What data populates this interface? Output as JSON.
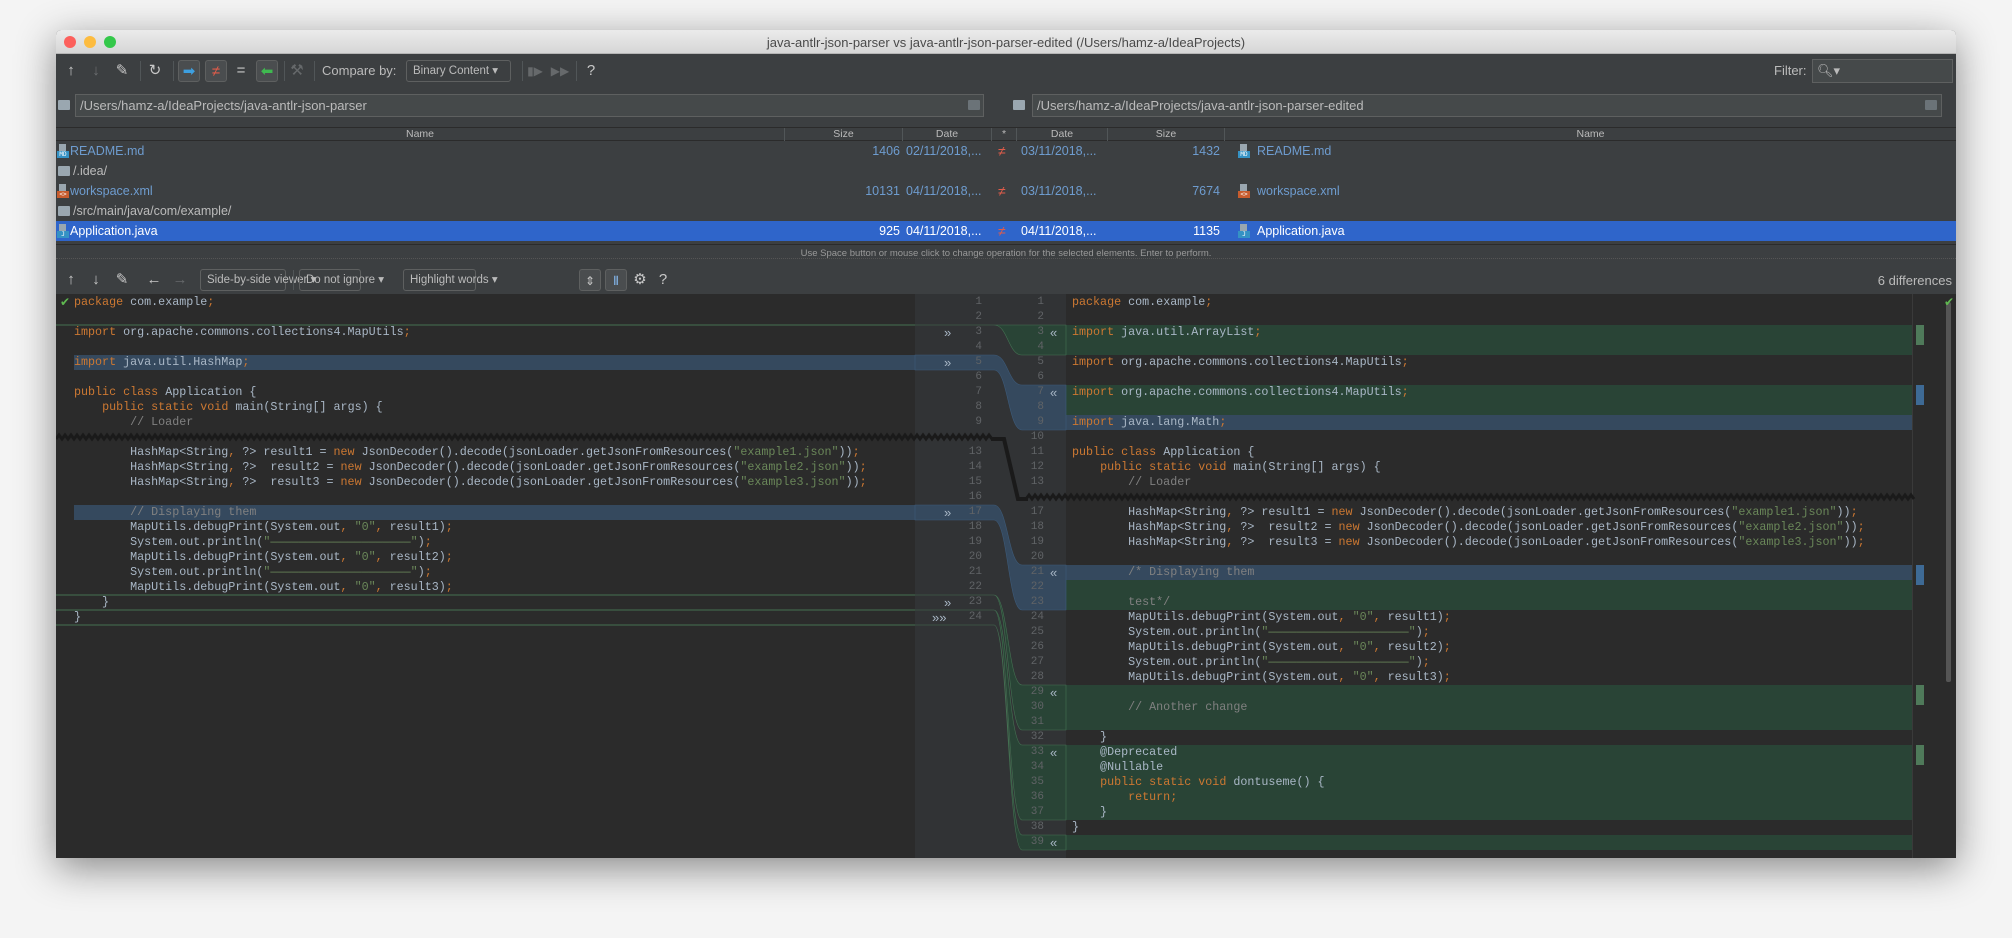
{
  "window": {
    "title": "java-antlr-json-parser vs java-antlr-json-parser-edited (/Users/hamz-a/IdeaProjects)"
  },
  "toolbar": {
    "compare_by_label": "Compare by:",
    "compare_by_value": "Binary Content",
    "filter_label": "Filter:",
    "help": "?"
  },
  "paths": {
    "left": "/Users/hamz-a/IdeaProjects/java-antlr-json-parser",
    "right": "/Users/hamz-a/IdeaProjects/java-antlr-json-parser-edited"
  },
  "table": {
    "headers": {
      "name": "Name",
      "size": "Size",
      "date": "Date",
      "star": "*"
    },
    "rows": [
      {
        "type": "file",
        "icon": "md",
        "left_name": "README.md",
        "left_size": "1406",
        "left_date": "02/11/2018,...",
        "status": "≠",
        "right_date": "03/11/2018,...",
        "right_size": "1432",
        "right_name": "README.md"
      },
      {
        "type": "dir",
        "left_name": "/.idea/"
      },
      {
        "type": "file",
        "icon": "xml",
        "left_name": "workspace.xml",
        "left_size": "10131",
        "left_date": "04/11/2018,...",
        "status": "≠",
        "right_date": "03/11/2018,...",
        "right_size": "7674",
        "right_name": "workspace.xml"
      },
      {
        "type": "dir",
        "left_name": "/src/main/java/com/example/"
      },
      {
        "type": "file",
        "icon": "java",
        "selected": true,
        "left_name": "Application.java",
        "left_size": "925",
        "left_date": "04/11/2018,...",
        "status": "≠",
        "right_date": "04/11/2018,...",
        "right_size": "1135",
        "right_name": "Application.java"
      }
    ]
  },
  "hint": "Use Space button or mouse click to change operation for the selected elements. Enter to perform.",
  "diff_toolbar": {
    "viewer": "Side-by-side viewer",
    "ignore": "Do not ignore",
    "highlight": "Highlight words",
    "help": "?",
    "differences": "6 differences"
  },
  "colors": {
    "keyword": "#cc7832",
    "string": "#6a8759",
    "comment": "#808080",
    "text": "#a9b7c6",
    "inserted": "#294436",
    "modified": "#35495e",
    "selection": "#2f65ca"
  },
  "left_lines": [
    {
      "n": 1,
      "t": "package com.example;"
    },
    {
      "n": 2,
      "t": ""
    },
    {
      "n": 3,
      "t": "import org.apache.commons.collections4.MapUtils;"
    },
    {
      "n": 4,
      "t": ""
    },
    {
      "n": 5,
      "t": "import java.util.HashMap;"
    },
    {
      "n": 6,
      "t": ""
    },
    {
      "n": 7,
      "t": "public class Application {"
    },
    {
      "n": 8,
      "t": "    public static void main(String[] args) {"
    },
    {
      "n": 9,
      "t": "        // Loader"
    },
    {
      "n": 13,
      "t": "        HashMap<String, ?> result1 = new JsonDecoder().decode(jsonLoader.getJsonFromResources(\"example1.json\"));"
    },
    {
      "n": 14,
      "t": "        HashMap<String, ?>  result2 = new JsonDecoder().decode(jsonLoader.getJsonFromResources(\"example2.json\"));"
    },
    {
      "n": 15,
      "t": "        HashMap<String, ?>  result3 = new JsonDecoder().decode(jsonLoader.getJsonFromResources(\"example3.json\"));"
    },
    {
      "n": 16,
      "t": ""
    },
    {
      "n": 17,
      "t": "        // Displaying them"
    },
    {
      "n": 18,
      "t": "        MapUtils.debugPrint(System.out, \"0\", result1);"
    },
    {
      "n": 19,
      "t": "        System.out.println(\"————————————————————\");"
    },
    {
      "n": 20,
      "t": "        MapUtils.debugPrint(System.out, \"0\", result2);"
    },
    {
      "n": 21,
      "t": "        System.out.println(\"————————————————————\");"
    },
    {
      "n": 22,
      "t": "        MapUtils.debugPrint(System.out, \"0\", result3);"
    },
    {
      "n": 23,
      "t": "    }"
    },
    {
      "n": 24,
      "t": "}"
    }
  ],
  "right_lines": [
    {
      "n": 1,
      "t": "package com.example;"
    },
    {
      "n": 2,
      "t": ""
    },
    {
      "n": 3,
      "t": "import java.util.ArrayList;"
    },
    {
      "n": 4,
      "t": ""
    },
    {
      "n": 5,
      "t": "import org.apache.commons.collections4.MapUtils;"
    },
    {
      "n": 6,
      "t": ""
    },
    {
      "n": 7,
      "t": "import org.apache.commons.collections4.MapUtils;"
    },
    {
      "n": 8,
      "t": ""
    },
    {
      "n": 9,
      "t": "import java.lang.Math;"
    },
    {
      "n": 10,
      "t": ""
    },
    {
      "n": 11,
      "t": "public class Application {"
    },
    {
      "n": 12,
      "t": "    public static void main(String[] args) {"
    },
    {
      "n": 13,
      "t": "        // Loader"
    },
    {
      "n": 17,
      "t": "        HashMap<String, ?> result1 = new JsonDecoder().decode(jsonLoader.getJsonFromResources(\"example1.json\"));"
    },
    {
      "n": 18,
      "t": "        HashMap<String, ?>  result2 = new JsonDecoder().decode(jsonLoader.getJsonFromResources(\"example2.json\"));"
    },
    {
      "n": 19,
      "t": "        HashMap<String, ?>  result3 = new JsonDecoder().decode(jsonLoader.getJsonFromResources(\"example3.json\"));"
    },
    {
      "n": 20,
      "t": ""
    },
    {
      "n": 21,
      "t": "        /* Displaying them"
    },
    {
      "n": 22,
      "t": ""
    },
    {
      "n": 23,
      "t": "        test*/"
    },
    {
      "n": 24,
      "t": "        MapUtils.debugPrint(System.out, \"0\", result1);"
    },
    {
      "n": 25,
      "t": "        System.out.println(\"————————————————————\");"
    },
    {
      "n": 26,
      "t": "        MapUtils.debugPrint(System.out, \"0\", result2);"
    },
    {
      "n": 27,
      "t": "        System.out.println(\"————————————————————\");"
    },
    {
      "n": 28,
      "t": "        MapUtils.debugPrint(System.out, \"0\", result3);"
    },
    {
      "n": 29,
      "t": ""
    },
    {
      "n": 30,
      "t": "        // Another change"
    },
    {
      "n": 31,
      "t": ""
    },
    {
      "n": 32,
      "t": "    }"
    },
    {
      "n": 33,
      "t": "    @Deprecated"
    },
    {
      "n": 34,
      "t": "    @Nullable"
    },
    {
      "n": 35,
      "t": "    public static void dontuseme() {"
    },
    {
      "n": 36,
      "t": "        return;"
    },
    {
      "n": 37,
      "t": "    }"
    },
    {
      "n": 38,
      "t": "}"
    },
    {
      "n": 39,
      "t": ""
    }
  ]
}
